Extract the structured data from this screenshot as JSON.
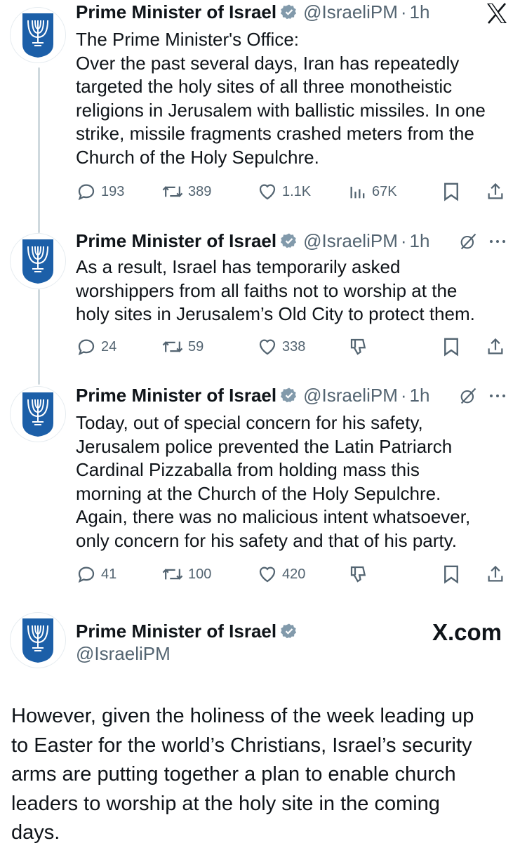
{
  "tweets": [
    {
      "author": "Prime Minister of Israel",
      "handle": "@IsraeliPM",
      "separator": "·",
      "time": "1h",
      "lines": [
        "The Prime Minister's Office:",
        "Over the past several days, Iran has repeatedly",
        "targeted the holy sites of all three monotheistic",
        "religions in Jerusalem with ballistic missiles. In one",
        "strike, missile fragments crashed meters from the",
        "Church of the Holy Sepulchre."
      ],
      "replies": "193",
      "reposts": "389",
      "likes": "1.1K",
      "views": "67K"
    },
    {
      "author": "Prime Minister of Israel",
      "handle": "@IsraeliPM",
      "separator": "·",
      "time": "1h",
      "lines": [
        "As a result, Israel has temporarily asked",
        "worshippers from all faiths not to worship at the",
        "holy sites in Jerusalem’s Old City to protect them."
      ],
      "replies": "24",
      "reposts": "59",
      "likes": "338"
    },
    {
      "author": "Prime Minister of Israel",
      "handle": "@IsraeliPM",
      "separator": "·",
      "time": "1h",
      "lines": [
        "Today, out of special concern for his safety,",
        "Jerusalem police prevented the Latin Patriarch",
        "Cardinal Pizzaballa from holding mass this",
        "morning at the Church of the Holy Sepulchre.",
        "Again, there was no malicious intent whatsoever,",
        "only concern for his safety and that of his party."
      ],
      "replies": "41",
      "reposts": "100",
      "likes": "420"
    }
  ],
  "card": {
    "author": "Prime Minister of Israel",
    "handle": "@IsraeliPM",
    "site": "X.com",
    "lines": [
      "However, given the holiness of the week leading up",
      "to Easter for the world’s Christians, Israel’s security",
      "arms are putting together a plan to enable church",
      "leaders to worship at the holy site in the coming",
      "days."
    ]
  },
  "icons": {
    "logo": "x-logo-icon",
    "verified": "verified-badge-icon",
    "reply": "reply-icon",
    "repost": "repost-icon",
    "like": "like-icon",
    "views": "views-icon",
    "bookmark": "bookmark-icon",
    "share": "share-icon",
    "grok": "grok-icon",
    "more": "more-icon",
    "dislike": "dislike-icon"
  },
  "colors": {
    "text": "#0f1419",
    "secondary": "#536471",
    "verified": "#829aab",
    "emblem": "#1c5fa8",
    "thread_line": "#cfd9de"
  }
}
